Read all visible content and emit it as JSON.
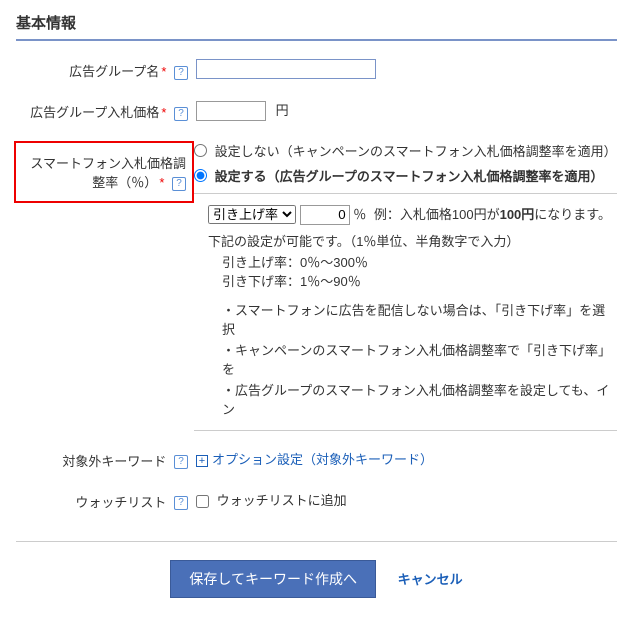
{
  "section_title": "基本情報",
  "rows": {
    "adgroup_name": {
      "label": "広告グループ名",
      "required": "*"
    },
    "adgroup_bid": {
      "label": "広告グループ入札価格",
      "required": "*",
      "unit": "円"
    },
    "sp_bid_adj": {
      "label": "スマートフォン入札価格調整率（％）",
      "required": "*"
    },
    "neg_keywords": {
      "label": "対象外キーワード",
      "link": "オプション設定（対象外キーワード）"
    },
    "watchlist": {
      "label": "ウォッチリスト",
      "checkbox_label": "ウォッチリストに追加"
    }
  },
  "sp_options": {
    "opt_none": "設定しない（キャンペーンのスマートフォン入札価格調整率を適用）",
    "opt_set": "設定する（広告グループのスマートフォン入札価格調整率を適用）",
    "direction_options": [
      "引き上げ率"
    ],
    "value": "0",
    "pct": "％",
    "example_prefix": "例：入札価格100円が",
    "example_bold": "100円",
    "example_suffix": "になります。",
    "range_head": "下記の設定が可能です。（1％単位、半角数字で入力）",
    "range_up": "引き上げ率：0％～300％",
    "range_down": "引き下げ率：1％～90％",
    "note1": "・スマートフォンに広告を配信しない場合は、「引き下げ率」を選択",
    "note2": "・キャンペーンのスマートフォン入札価格調整率で「引き下げ率」を",
    "note3": "・広告グループのスマートフォン入札価格調整率を設定しても、イン"
  },
  "footer": {
    "save": "保存してキーワード作成へ",
    "cancel": "キャンセル"
  }
}
